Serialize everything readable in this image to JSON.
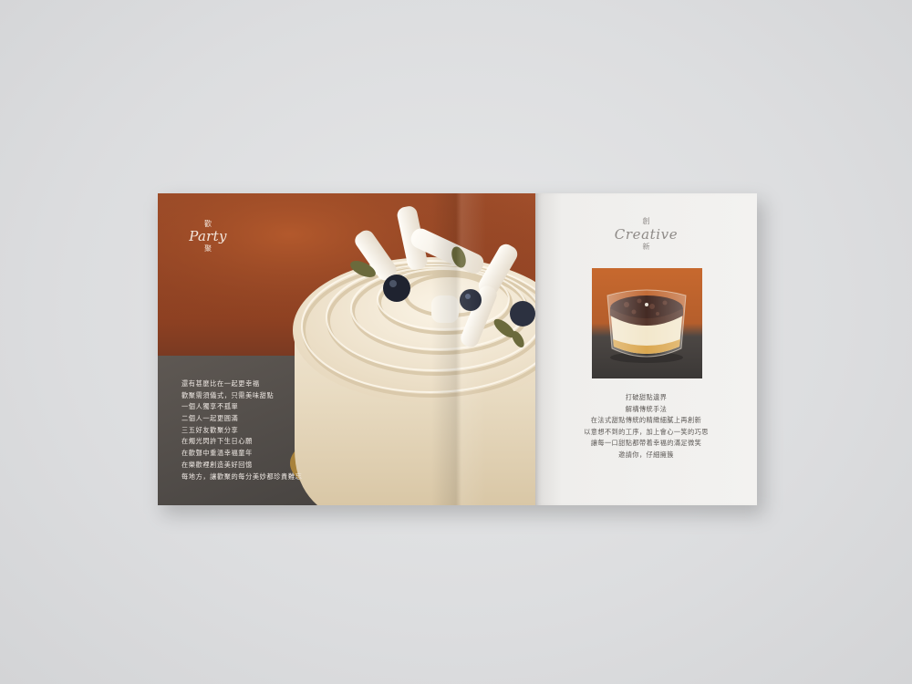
{
  "left_page": {
    "heading_top": "歡",
    "heading_latin": "Party",
    "heading_bottom": "聚",
    "poem_lines": [
      "還有甚麼比在一起更幸福",
      "歡聚需須儀式，只需美味甜點",
      "一個人獨享不孤單",
      "二個人一起更圓滿",
      "三五好友歡聚分享",
      "在燭光閃許下生日心願",
      "在歡聲中重溫幸福童年",
      "在樂歡裡創造美好回憶",
      "每地方，讓歡聚的每分美妙都珍貴難忘"
    ]
  },
  "right_page": {
    "heading_top": "創",
    "heading_latin": "Creative",
    "heading_bottom": "新",
    "description_lines": [
      "打破甜點邊界",
      "解構傳統手法",
      "在法式甜點傳統的精緻細膩上再創新",
      "以意想不到的工序，加上會心一笑的巧思",
      "讓每一口甜點都帶着幸福的滿足微笑",
      "邀請你，仔細擁簇"
    ]
  },
  "colors": {
    "background": "#dcdddf",
    "left_photo_backdrop": "#9a4a28",
    "slate": "#4f4b48",
    "cream": "#f1e6d2",
    "right_page": "#f1f0ee",
    "text_gray": "#5d5956"
  }
}
